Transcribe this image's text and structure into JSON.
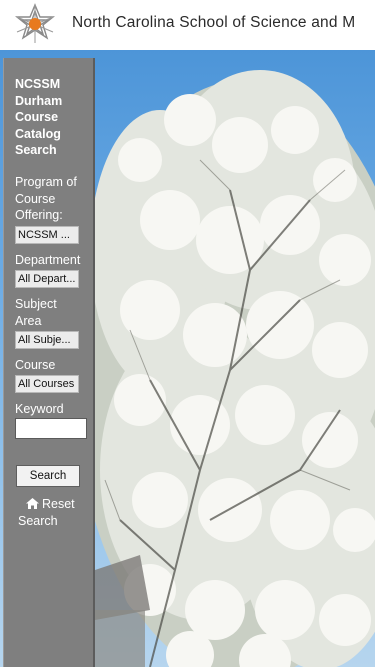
{
  "header": {
    "site_title": "North Carolina School of Science and M",
    "logo_icon": "ncssm-star-logo-icon"
  },
  "sidebar": {
    "catalog_title": "NCSSM Durham Course Catalog Search",
    "program_label": "Program of Course Offering:",
    "program_value": "NCSSM ...",
    "department_label": "Department",
    "department_value": "All Depart...",
    "subject_label": "Subject Area",
    "subject_value": "All Subje...",
    "course_label": "Course",
    "course_value": "All Courses",
    "keyword_label": "Keyword",
    "keyword_value": "",
    "search_label": "Search",
    "reset_label": "Reset Search",
    "reset_icon": "home-icon"
  },
  "colors": {
    "sidebar_bg": "#7f7f7f",
    "sky": "#5a9fe0",
    "blossom": "#f4f4ef",
    "logo_orange": "#e87a1e"
  }
}
